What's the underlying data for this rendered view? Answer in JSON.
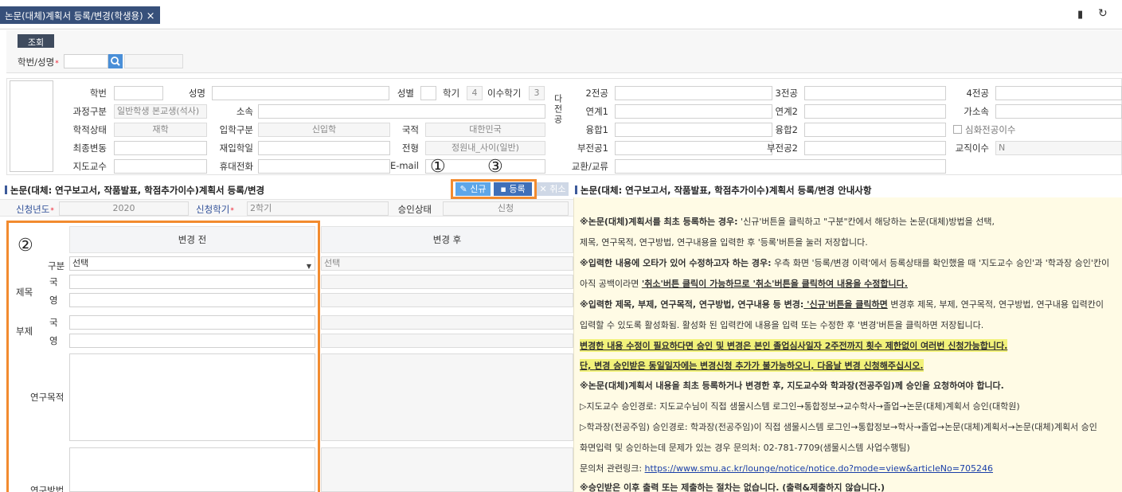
{
  "tab": {
    "title": "논문(대체)계획서 등록/변경(학생용)",
    "close": "×"
  },
  "toolbar": {
    "bookmark": "▮",
    "refresh": "↻"
  },
  "search": {
    "button": "조회",
    "label": "학번/성명",
    "required": "*",
    "id_value": "",
    "name_value": ""
  },
  "info": {
    "labels": {
      "student_no": "학번",
      "name": "성명",
      "gender": "성별",
      "grade": "학기",
      "completed": "이수학기",
      "course": "과정구분",
      "dept": "소속",
      "status": "학적상태",
      "admission": "입학구분",
      "nationality": "국적",
      "last_change": "최종변동",
      "readmit": "재입학일",
      "track": "전형",
      "advisor": "지도교수",
      "mobile": "휴대전화",
      "email": "E-mail",
      "multi_major": "다전공",
      "major2": "2전공",
      "major3": "3전공",
      "major4": "4전공",
      "link1": "연계1",
      "link2": "연계2",
      "affil": "가소속",
      "fusion1": "융합1",
      "fusion2": "융합2",
      "deep_major": "심화전공이수",
      "minor1": "부전공1",
      "minor2": "부전공2",
      "teaching": "교직이수",
      "exchange": "교환/교류"
    },
    "values": {
      "grade": "4",
      "completed": "3",
      "course": "일반학생 본교생(석사)",
      "status": "재학",
      "admission": "신입학",
      "nationality": "대한민국",
      "track": "정원내_사이(일반)",
      "teaching": "N"
    }
  },
  "register": {
    "title": "논문(대체: 연구보고서, 작품발표, 학점추가이수)계획서 등록/변경",
    "buttons": {
      "new": "신규",
      "save": "등록",
      "cancel": "취소"
    },
    "year_label": "신청년도",
    "year_value": "2020",
    "term_label": "신청학기",
    "term_value": "2학기",
    "approval_label": "승인상태",
    "approval_value": "신청",
    "before": "변경 전",
    "after": "변경 후",
    "type_label": "구분",
    "type_before": "선택",
    "type_after": "선택",
    "title_label": "제목",
    "subtitle_label": "부제",
    "kor": "국",
    "eng": "영",
    "purpose_label": "연구목적",
    "method_label": "연구방법"
  },
  "annotations": {
    "one": "①",
    "two": "②",
    "three": "③"
  },
  "notice": {
    "title": "논문(대체: 연구보고서, 작품발표, 학점추가이수)계획서 등록/변경 안내사항",
    "l1a": "※논문(대체)계획서를 최초 등록하는 경우:",
    "l1b": " '신규'버튼을 클릭하고 \"구분\"칸에서 해당하는 논문(대체)방법을 선택,",
    "l2": "제목, 연구목적, 연구방법, 연구내용을 입력한 후 '등록'버튼을 눌러 저장합니다.",
    "l3a": "※입력한 내용에 오타가 있어 수정하고자 하는 경우:",
    "l3b": " 우측 화면 '등록/변경 이력'에서 등록상태를 확인했을 때 '지도교수 승인'과 '학과장 승인'칸이",
    "l4a": "아직 공백이라면 ",
    "l4b": "'취소'버튼 클릭이 가능하므로 '취소'버튼을 클릭하여 내용을 수정합니다.",
    "l5a": "※입력한 제목, 부제, 연구목적, 연구방법, 연구내용 등 변경:",
    "l5b": " '신규'버튼을 클릭하면",
    "l5c": " 변경후 제목, 부제, 연구목적, 연구방법, 연구내용 입력칸이",
    "l6": "입력할 수 있도록 활성화됨. 활성화 된 입력칸에 내용을 입력 또는 수정한 후 '변경'버튼을 클릭하면 저장됩니다.",
    "l7": "변경한 내용 수정이 필요하다면 승인 및 변경은 본인 졸업심사일자 2주전까지 횟수 제한없이 여러번 신청가능합니다.",
    "l8": "단, 변경 승인받은 동일일자에는 변경신청 추가가 불가능하오니, 다음날 변경 신청해주십시오.",
    "l9": "※논문(대체)계획서 내용을 최초 등록하거나 변경한 후, 지도교수와 학과장(전공주임)께 승인을 요청하여야 합니다.",
    "l10": "▷지도교수 승인경로: 지도교수님이 직접 샘물시스템 로그인→통합정보→교수학사→졸업→논문(대체)계획서 승인(대학원)",
    "l11": "▷학과장(전공주임) 승인경로: 학과장(전공주임)이 직접 샘물시스템 로그인→통합정보→학사→졸업→논문(대체)계획서→논문(대체)계획서 승인",
    "l12": "화면입력 및 승인하는데 문제가 있는 경우 문의처: 02-781-7709(샘물시스템 사업수행팀)",
    "l13a": "문의처 관련링크: ",
    "l13b": "https://www.smu.ac.kr/lounge/notice/notice.do?mode=view&articleNo=705246",
    "l14": "※승인받은 이후 출력 또는 제출하는 절차는 없습니다. (출력&제출하지 않습니다.)"
  },
  "colors": {
    "tab": "#37507a",
    "accent": "#3d5a9a",
    "orange": "#f28b2f",
    "notice_bg": "#fffbe5",
    "highlight": "#f2f27a"
  }
}
